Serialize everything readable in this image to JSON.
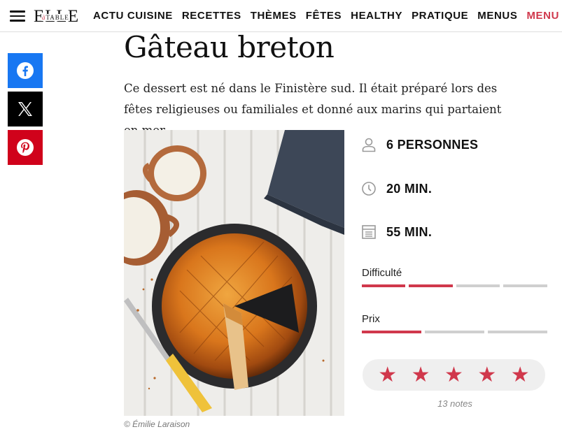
{
  "header": {
    "logo_main": "ELLE",
    "logo_sub": "TABLE",
    "logo_prefix": "à",
    "nav": [
      "ACTU CUISINE",
      "RECETTES",
      "THÈMES",
      "FÊTES",
      "HEALTHY",
      "PRATIQUE",
      "MENUS"
    ],
    "nav_accent": "MENU DE L"
  },
  "share": {
    "icons": [
      "facebook-icon",
      "x-icon",
      "pinterest-icon"
    ],
    "colors": [
      "#1877f2",
      "#000000",
      "#d0021b"
    ]
  },
  "recipe": {
    "title": "Gâteau breton",
    "intro": "Ce dessert est né dans le Finistère sud. Il était préparé lors des fêtes religieuses ou familiales et donné aux marins qui partaient en mer.",
    "photo_credit": "© Émilie Laraison",
    "servings": "6 PERSONNES",
    "prep_time": "20 MIN.",
    "cook_time": "55 MIN.",
    "difficulty_label": "Difficulté",
    "difficulty_level": 2,
    "difficulty_max": 4,
    "price_label": "Prix",
    "price_level": 1,
    "price_max": 3,
    "rating_stars": 5,
    "ratings_count": "13 notes"
  },
  "colors": {
    "accent": "#d0384c"
  }
}
